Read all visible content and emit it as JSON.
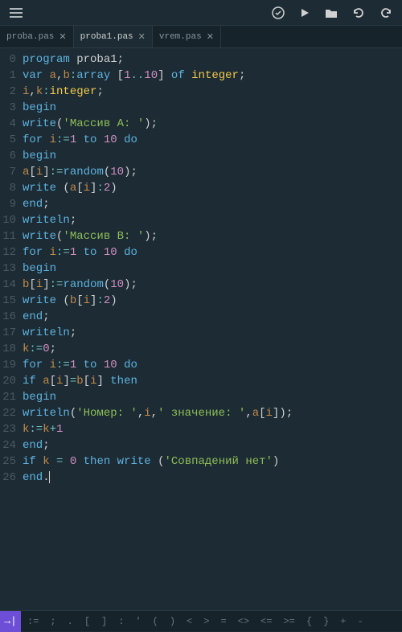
{
  "tabs": [
    {
      "label": "proba.pas",
      "active": false
    },
    {
      "label": "proba1.pas",
      "active": true
    },
    {
      "label": "vrem.pas",
      "active": false
    }
  ],
  "statusbar": {
    "indent_icon": "→|",
    "symbols": [
      ":=",
      ";",
      ".",
      "[",
      "]",
      ":",
      "'",
      "(",
      ")",
      "<",
      ">",
      "=",
      "<>",
      "<=",
      ">=",
      "{",
      "}",
      "+",
      "-"
    ]
  },
  "code": {
    "lines": [
      {
        "n": "0",
        "tokens": [
          [
            "kw",
            "program"
          ],
          [
            "id",
            " "
          ],
          [
            "id",
            "proba1"
          ],
          [
            "punc",
            ";"
          ]
        ]
      },
      {
        "n": "1",
        "tokens": [
          [
            "kw",
            "var"
          ],
          [
            "id",
            " "
          ],
          [
            "var",
            "a"
          ],
          [
            "punc",
            ","
          ],
          [
            "var",
            "b"
          ],
          [
            "op",
            ":"
          ],
          [
            "kw",
            "array"
          ],
          [
            "id",
            " "
          ],
          [
            "punc",
            "["
          ],
          [
            "num",
            "1"
          ],
          [
            "op",
            ".."
          ],
          [
            "num",
            "10"
          ],
          [
            "punc",
            "]"
          ],
          [
            "id",
            " "
          ],
          [
            "kw",
            "of"
          ],
          [
            "id",
            " "
          ],
          [
            "ty",
            "integer"
          ],
          [
            "punc",
            ";"
          ]
        ]
      },
      {
        "n": "2",
        "tokens": [
          [
            "var",
            "i"
          ],
          [
            "punc",
            ","
          ],
          [
            "var",
            "k"
          ],
          [
            "op",
            ":"
          ],
          [
            "ty",
            "integer"
          ],
          [
            "punc",
            ";"
          ]
        ]
      },
      {
        "n": "3",
        "tokens": [
          [
            "kw",
            "begin"
          ]
        ]
      },
      {
        "n": "4",
        "tokens": [
          [
            "fn",
            "write"
          ],
          [
            "punc",
            "("
          ],
          [
            "str",
            "'Массив A: '"
          ],
          [
            "punc",
            ")"
          ],
          [
            "punc",
            ";"
          ]
        ]
      },
      {
        "n": "5",
        "tokens": [
          [
            "kw",
            "for"
          ],
          [
            "id",
            " "
          ],
          [
            "var",
            "i"
          ],
          [
            "op",
            ":="
          ],
          [
            "num",
            "1"
          ],
          [
            "id",
            " "
          ],
          [
            "kw",
            "to"
          ],
          [
            "id",
            " "
          ],
          [
            "num",
            "10"
          ],
          [
            "id",
            " "
          ],
          [
            "kw",
            "do"
          ]
        ]
      },
      {
        "n": "6",
        "tokens": [
          [
            "kw",
            "begin"
          ]
        ]
      },
      {
        "n": "7",
        "tokens": [
          [
            "var",
            "a"
          ],
          [
            "punc",
            "["
          ],
          [
            "var",
            "i"
          ],
          [
            "punc",
            "]"
          ],
          [
            "op",
            ":="
          ],
          [
            "rnd",
            "random"
          ],
          [
            "punc",
            "("
          ],
          [
            "num",
            "10"
          ],
          [
            "punc",
            ")"
          ],
          [
            "punc",
            ";"
          ]
        ]
      },
      {
        "n": "8",
        "tokens": [
          [
            "fn",
            "write"
          ],
          [
            "id",
            " "
          ],
          [
            "punc",
            "("
          ],
          [
            "var",
            "a"
          ],
          [
            "punc",
            "["
          ],
          [
            "var",
            "i"
          ],
          [
            "punc",
            "]"
          ],
          [
            "op",
            ":"
          ],
          [
            "num",
            "2"
          ],
          [
            "punc",
            ")"
          ]
        ]
      },
      {
        "n": "9",
        "tokens": [
          [
            "kw",
            "end"
          ],
          [
            "punc",
            ";"
          ]
        ]
      },
      {
        "n": "10",
        "tokens": [
          [
            "fn",
            "writeln"
          ],
          [
            "punc",
            ";"
          ]
        ]
      },
      {
        "n": "11",
        "tokens": [
          [
            "fn",
            "write"
          ],
          [
            "punc",
            "("
          ],
          [
            "str",
            "'Массив B: '"
          ],
          [
            "punc",
            ")"
          ],
          [
            "punc",
            ";"
          ]
        ]
      },
      {
        "n": "12",
        "tokens": [
          [
            "kw",
            "for"
          ],
          [
            "id",
            " "
          ],
          [
            "var",
            "i"
          ],
          [
            "op",
            ":="
          ],
          [
            "num",
            "1"
          ],
          [
            "id",
            " "
          ],
          [
            "kw",
            "to"
          ],
          [
            "id",
            " "
          ],
          [
            "num",
            "10"
          ],
          [
            "id",
            " "
          ],
          [
            "kw",
            "do"
          ]
        ]
      },
      {
        "n": "13",
        "tokens": [
          [
            "kw",
            "begin"
          ]
        ]
      },
      {
        "n": "14",
        "tokens": [
          [
            "var",
            "b"
          ],
          [
            "punc",
            "["
          ],
          [
            "var",
            "i"
          ],
          [
            "punc",
            "]"
          ],
          [
            "op",
            ":="
          ],
          [
            "rnd",
            "random"
          ],
          [
            "punc",
            "("
          ],
          [
            "num",
            "10"
          ],
          [
            "punc",
            ")"
          ],
          [
            "punc",
            ";"
          ]
        ]
      },
      {
        "n": "15",
        "tokens": [
          [
            "fn",
            "write"
          ],
          [
            "id",
            " "
          ],
          [
            "punc",
            "("
          ],
          [
            "var",
            "b"
          ],
          [
            "punc",
            "["
          ],
          [
            "var",
            "i"
          ],
          [
            "punc",
            "]"
          ],
          [
            "op",
            ":"
          ],
          [
            "num",
            "2"
          ],
          [
            "punc",
            ")"
          ]
        ]
      },
      {
        "n": "16",
        "tokens": [
          [
            "kw",
            "end"
          ],
          [
            "punc",
            ";"
          ]
        ]
      },
      {
        "n": "17",
        "tokens": [
          [
            "fn",
            "writeln"
          ],
          [
            "punc",
            ";"
          ]
        ]
      },
      {
        "n": "18",
        "tokens": [
          [
            "var",
            "k"
          ],
          [
            "op",
            ":="
          ],
          [
            "num",
            "0"
          ],
          [
            "punc",
            ";"
          ]
        ]
      },
      {
        "n": "19",
        "tokens": [
          [
            "kw",
            "for"
          ],
          [
            "id",
            " "
          ],
          [
            "var",
            "i"
          ],
          [
            "op",
            ":="
          ],
          [
            "num",
            "1"
          ],
          [
            "id",
            " "
          ],
          [
            "kw",
            "to"
          ],
          [
            "id",
            " "
          ],
          [
            "num",
            "10"
          ],
          [
            "id",
            " "
          ],
          [
            "kw",
            "do"
          ]
        ]
      },
      {
        "n": "20",
        "tokens": [
          [
            "kw",
            "if"
          ],
          [
            "id",
            " "
          ],
          [
            "var",
            "a"
          ],
          [
            "punc",
            "["
          ],
          [
            "var",
            "i"
          ],
          [
            "punc",
            "]"
          ],
          [
            "op",
            "="
          ],
          [
            "var",
            "b"
          ],
          [
            "punc",
            "["
          ],
          [
            "var",
            "i"
          ],
          [
            "punc",
            "]"
          ],
          [
            "id",
            " "
          ],
          [
            "kw",
            "then"
          ]
        ]
      },
      {
        "n": "21",
        "tokens": [
          [
            "kw",
            "begin"
          ]
        ]
      },
      {
        "n": "22",
        "tokens": [
          [
            "fn",
            "writeln"
          ],
          [
            "punc",
            "("
          ],
          [
            "str",
            "'Номер: '"
          ],
          [
            "punc",
            ","
          ],
          [
            "var",
            "i"
          ],
          [
            "punc",
            ","
          ],
          [
            "str",
            "' значение: '"
          ],
          [
            "punc",
            ","
          ],
          [
            "var",
            "a"
          ],
          [
            "punc",
            "["
          ],
          [
            "var",
            "i"
          ],
          [
            "punc",
            "]"
          ],
          [
            "punc",
            ")"
          ],
          [
            "punc",
            ";"
          ]
        ]
      },
      {
        "n": "23",
        "tokens": [
          [
            "var",
            "k"
          ],
          [
            "op",
            ":="
          ],
          [
            "var",
            "k"
          ],
          [
            "op",
            "+"
          ],
          [
            "num",
            "1"
          ]
        ]
      },
      {
        "n": "24",
        "tokens": [
          [
            "kw",
            "end"
          ],
          [
            "punc",
            ";"
          ]
        ]
      },
      {
        "n": "25",
        "tokens": [
          [
            "kw",
            "if"
          ],
          [
            "id",
            " "
          ],
          [
            "var",
            "k"
          ],
          [
            "id",
            " "
          ],
          [
            "op",
            "="
          ],
          [
            "id",
            " "
          ],
          [
            "num",
            "0"
          ],
          [
            "id",
            " "
          ],
          [
            "kw",
            "then"
          ],
          [
            "id",
            " "
          ],
          [
            "fn",
            "write"
          ],
          [
            "id",
            " "
          ],
          [
            "punc",
            "("
          ],
          [
            "str",
            "'Совпадений нет'"
          ],
          [
            "punc",
            ")"
          ]
        ]
      },
      {
        "n": "26",
        "tokens": [
          [
            "kw",
            "end"
          ],
          [
            "punc",
            "."
          ]
        ],
        "cursor": true
      }
    ]
  }
}
